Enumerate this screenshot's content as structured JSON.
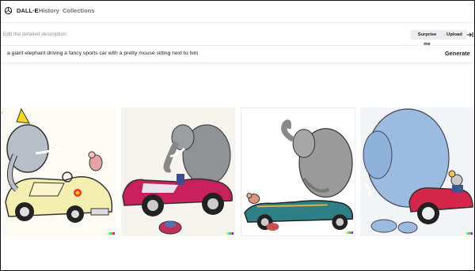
{
  "nav": {
    "brand": "DALL·E",
    "history": "History",
    "collections": "Collections"
  },
  "prompt": {
    "label": "Edit the detailed description",
    "surprise_label": "Surprise me",
    "upload_label": "Upload",
    "text": "a giant elephant driving a fancy sports car with a pretty mouse sitting next to him",
    "generate_label": "Generate"
  },
  "icons": {
    "logo": "openai-logo-icon",
    "upload_arrow": "arrow-right-to-bar-icon"
  },
  "gallery": {
    "images": [
      {
        "alt": "elephant in yellow car cartoon"
      },
      {
        "alt": "elephant in pink car cartoon"
      },
      {
        "alt": "elephant in teal car sketch"
      },
      {
        "alt": "blue elephant with mouse in red car"
      }
    ]
  },
  "colors": {
    "signature": [
      "#ffff66",
      "#42ffff",
      "#51da4c",
      "#ff6e3c",
      "#3c46ff"
    ]
  }
}
